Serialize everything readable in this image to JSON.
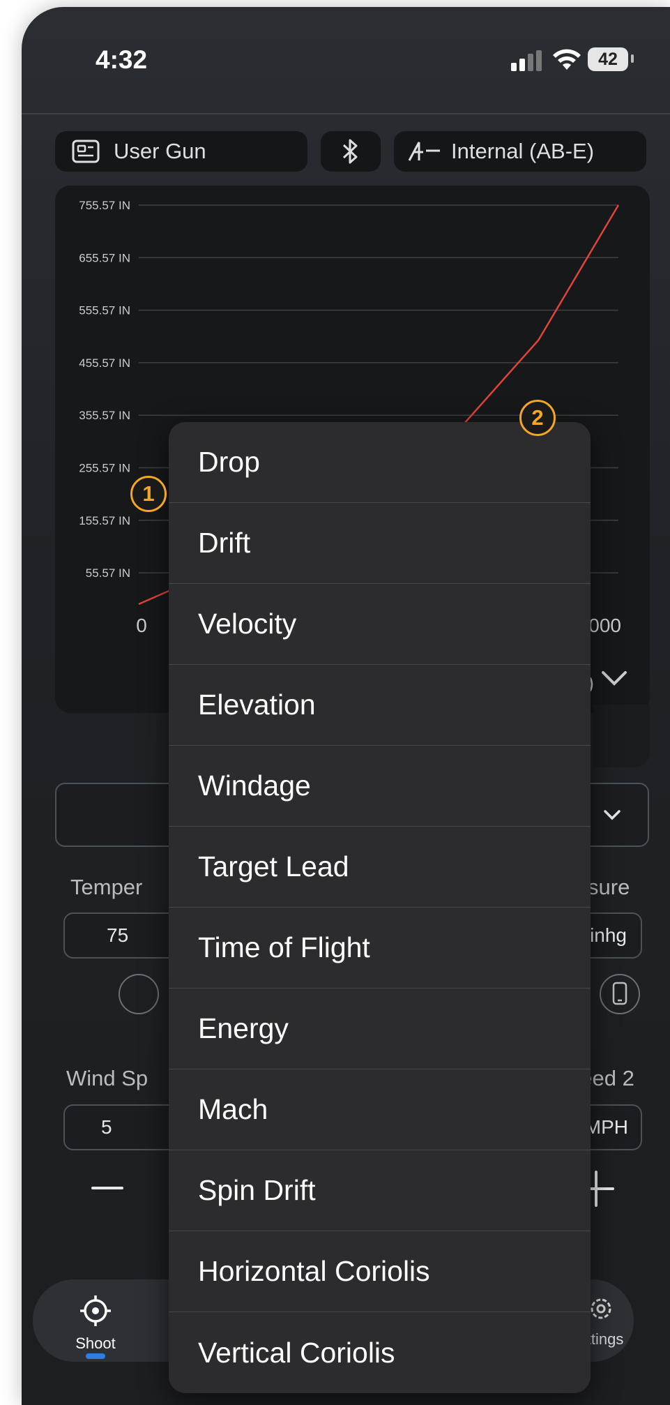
{
  "status_bar": {
    "time": "4:32",
    "battery": "42"
  },
  "top_bar": {
    "gun_label": "User Gun",
    "ballistics_label": "Internal (AB-E)"
  },
  "chart_data": {
    "type": "line",
    "y_tick_labels": [
      "755.57 IN",
      "655.57 IN",
      "555.57 IN",
      "455.57 IN",
      "355.57 IN",
      "255.57 IN",
      "155.57 IN",
      "55.57 IN"
    ],
    "x_tick_labels": [
      "0",
      "3,000"
    ],
    "axis_selector_fragment": "IN)",
    "series": [
      {
        "color": "#e0443c",
        "x": [
          0,
          1500,
          2000,
          2500,
          3000
        ],
        "y": [
          0,
          200,
          330,
          500,
          755.57
        ]
      }
    ],
    "xlim": [
      0,
      3000
    ],
    "ylim": [
      0,
      755.57
    ],
    "grid": true
  },
  "dropdown": {
    "chevron": "chevron-down"
  },
  "fields": {
    "temperature_label_fragment": "Temper",
    "temperature_value": "75",
    "pressure_label_fragment": "sure",
    "pressure_unit": "inhg",
    "wind_speed_label_fragment": "Wind Sp",
    "wind_speed_value": "5",
    "wind_speed2_label_fragment": "peed 2",
    "wind_speed2_unit": "MPH"
  },
  "nav": {
    "shoot_label": "Shoot",
    "settings_label_fragment": "ettings"
  },
  "menu": {
    "items": [
      "Drop",
      "Drift",
      "Velocity",
      "Elevation",
      "Windage",
      "Target Lead",
      "Time of Flight",
      "Energy",
      "Mach",
      "Spin Drift",
      "Horizontal Coriolis",
      "Vertical Coriolis"
    ]
  },
  "badges": {
    "one": "1",
    "two": "2"
  },
  "colors": {
    "accent": "#f5a623",
    "curve": "#e0443c",
    "nav_indicator": "#2f7de1"
  }
}
